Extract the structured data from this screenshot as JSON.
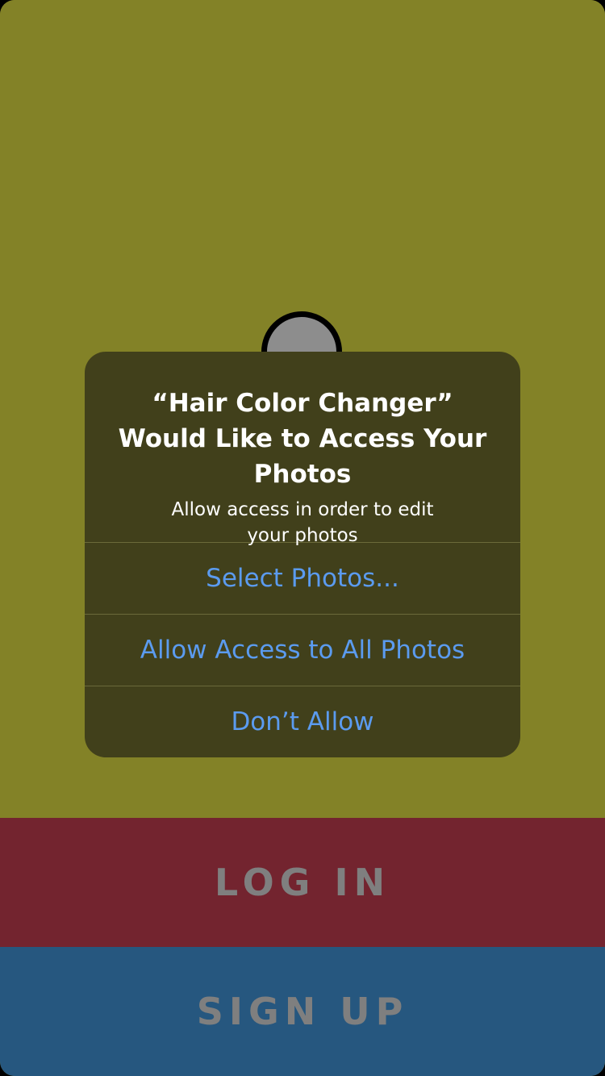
{
  "app": {
    "background_color": "#838227"
  },
  "buttons": {
    "login_label": "LOG IN",
    "login_color": "#73242f",
    "signup_label": "SIGN UP",
    "signup_color": "#26577f"
  },
  "alert": {
    "title": "“Hair Color Changer” Would Like to Access Your Photos",
    "message": "Allow access in order to edit your photos",
    "actions": [
      {
        "label": "Select Photos..."
      },
      {
        "label": "Allow Access to All Photos"
      },
      {
        "label": "Don’t Allow"
      }
    ],
    "action_color": "#5b9bef"
  },
  "icons": {
    "avatar": "avatar-placeholder-icon"
  }
}
